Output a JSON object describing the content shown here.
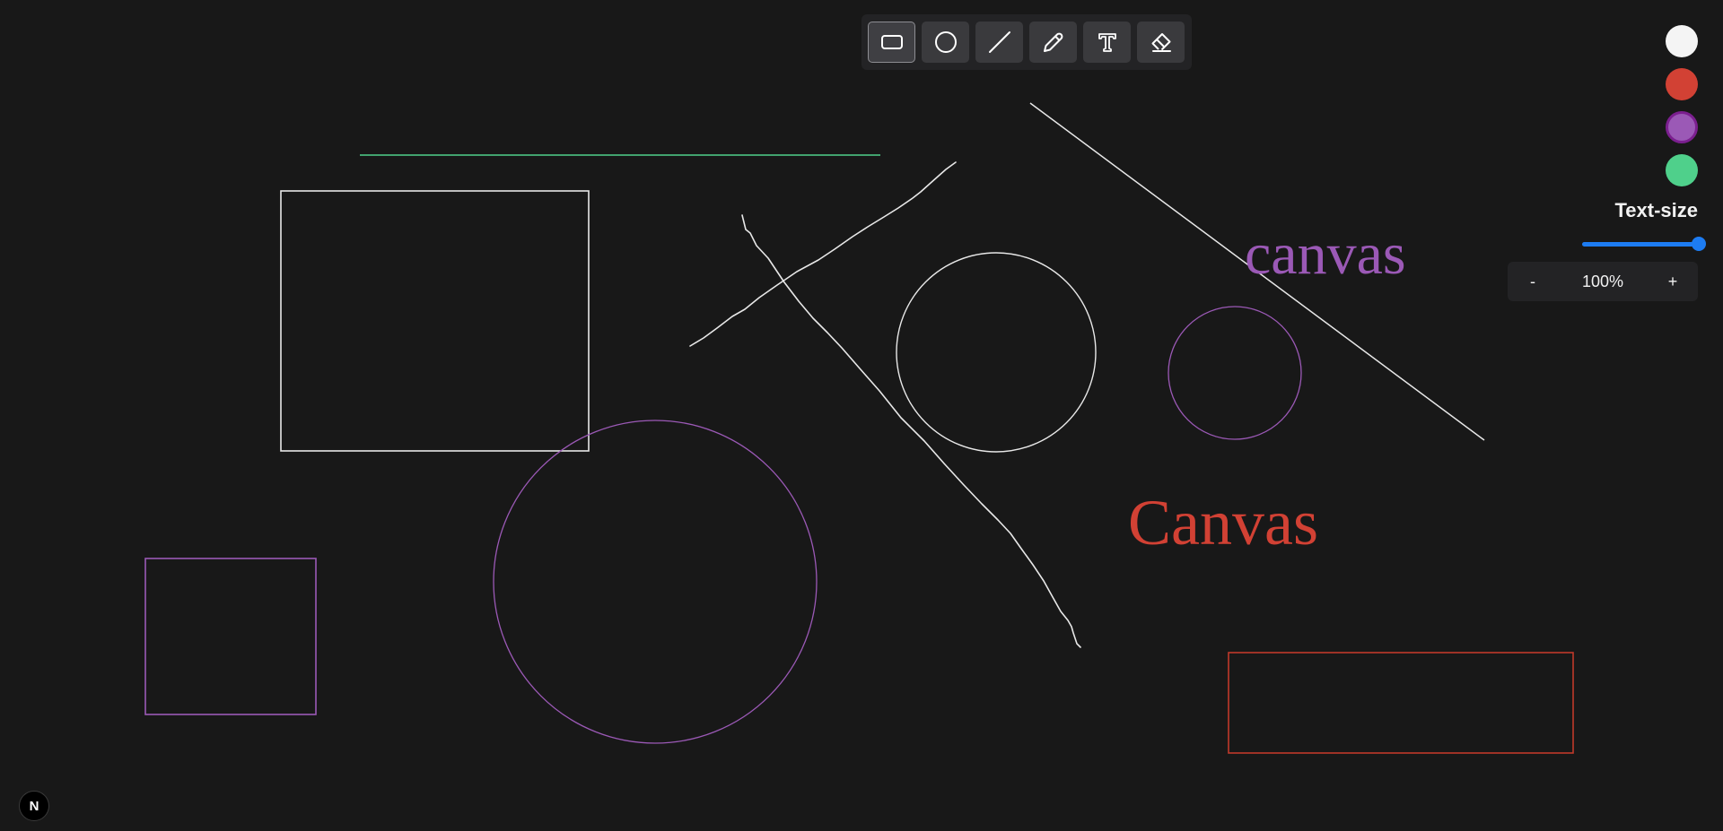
{
  "toolbar": {
    "tools": [
      {
        "icon": "rectangle-icon",
        "active": true
      },
      {
        "icon": "circle-icon",
        "active": false
      },
      {
        "icon": "line-icon",
        "active": false
      },
      {
        "icon": "pencil-icon",
        "active": false
      },
      {
        "icon": "text-icon",
        "active": false
      },
      {
        "icon": "eraser-icon",
        "active": false
      }
    ]
  },
  "palette": {
    "colors": [
      "#f4f4f4",
      "#d24134",
      "#9b59b6",
      "#4fd08b"
    ],
    "selected_index": 2
  },
  "text_size": {
    "label": "Text-size",
    "value_fraction": 1.0
  },
  "zoom": {
    "minus": "-",
    "value": "100%",
    "plus": "+"
  },
  "badge": {
    "letter": "N"
  },
  "canvas": {
    "texts": [
      {
        "text": "canvas",
        "color": "#9b59b6"
      },
      {
        "text": "Canvas",
        "color": "#d24134"
      }
    ],
    "shape_colors": {
      "white": "#e8e8e8",
      "purple": "#9b59b6",
      "red": "#c0392b",
      "green": "#4fd08b"
    }
  }
}
